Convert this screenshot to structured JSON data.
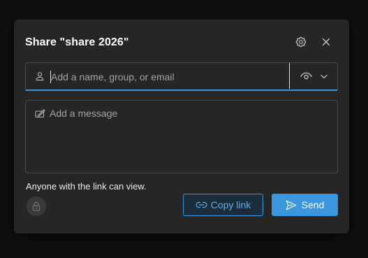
{
  "dialog": {
    "title": "Share \"share 2026\"",
    "settings_icon": "gear-icon",
    "close_icon": "close-icon"
  },
  "recipient": {
    "placeholder": "Add a name, group, or email",
    "value": "",
    "icon": "person-icon",
    "permission_icon": "eye-icon",
    "dropdown_icon": "chevron-down-icon"
  },
  "message": {
    "placeholder": "Add a message",
    "value": "",
    "icon": "edit-message-icon"
  },
  "link_info": "Anyone with the link can view.",
  "actions": {
    "lock_icon": "lock-icon",
    "copy_link_label": "Copy link",
    "copy_link_icon": "link-icon",
    "send_label": "Send",
    "send_icon": "send-icon"
  },
  "colors": {
    "accent": "#3a96dd",
    "dialog_bg": "#262626",
    "backdrop": "#0f0f0f"
  }
}
